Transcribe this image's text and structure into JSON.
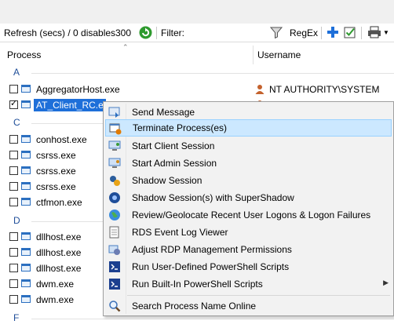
{
  "toolbar": {
    "refresh_label": "Refresh (secs) / 0 disables",
    "refresh_value": "300",
    "filter_label": "Filter:",
    "regex_label": "RegEx"
  },
  "columns": {
    "process": "Process",
    "username": "Username"
  },
  "groups": {
    "a": "A",
    "c": "C",
    "d": "D",
    "f": "F"
  },
  "rows": [
    {
      "name": "AggregatorHost.exe",
      "user": "NT AUTHORITY\\SYSTEM",
      "checked": false
    },
    {
      "name": "AT_Client_RC.exe",
      "user": "",
      "checked": true,
      "selected": true
    },
    {
      "name": "conhost.exe",
      "checked": false
    },
    {
      "name": "csrss.exe",
      "checked": false
    },
    {
      "name": "csrss.exe",
      "checked": false
    },
    {
      "name": "csrss.exe",
      "checked": false
    },
    {
      "name": "ctfmon.exe",
      "checked": false
    },
    {
      "name": "dllhost.exe",
      "checked": false
    },
    {
      "name": "dllhost.exe",
      "checked": false
    },
    {
      "name": "dllhost.exe",
      "checked": false
    },
    {
      "name": "dwm.exe",
      "checked": false
    },
    {
      "name": "dwm.exe",
      "checked": false
    }
  ],
  "selected_row_display": "AT_Client_RC.e",
  "context_menu": {
    "items": [
      {
        "label": "Send Message",
        "icon": "message-icon"
      },
      {
        "label": "Terminate Process(es)",
        "icon": "terminate-icon",
        "highlighted": true
      },
      {
        "label": "Start Client Session",
        "icon": "client-session-icon"
      },
      {
        "label": "Start Admin Session",
        "icon": "admin-session-icon"
      },
      {
        "label": "Shadow Session",
        "icon": "shadow-icon"
      },
      {
        "label": "Shadow Session(s) with SuperShadow",
        "icon": "supershadow-icon"
      },
      {
        "label": "Review/Geolocate Recent User Logons & Logon Failures",
        "icon": "globe-icon"
      },
      {
        "label": "RDS Event Log Viewer",
        "icon": "log-icon"
      },
      {
        "label": "Adjust RDP Management Permissions",
        "icon": "permissions-icon"
      },
      {
        "label": "Run User-Defined PowerShell Scripts",
        "icon": "powershell-icon"
      },
      {
        "label": "Run Built-In PowerShell Scripts",
        "icon": "powershell-icon",
        "submenu": true
      },
      {
        "label": "Search Process Name Online",
        "icon": "search-icon"
      }
    ]
  },
  "colors": {
    "accent": "#1e6fd9",
    "menu_highlight": "#cce8ff",
    "group": "#1f4e99"
  }
}
